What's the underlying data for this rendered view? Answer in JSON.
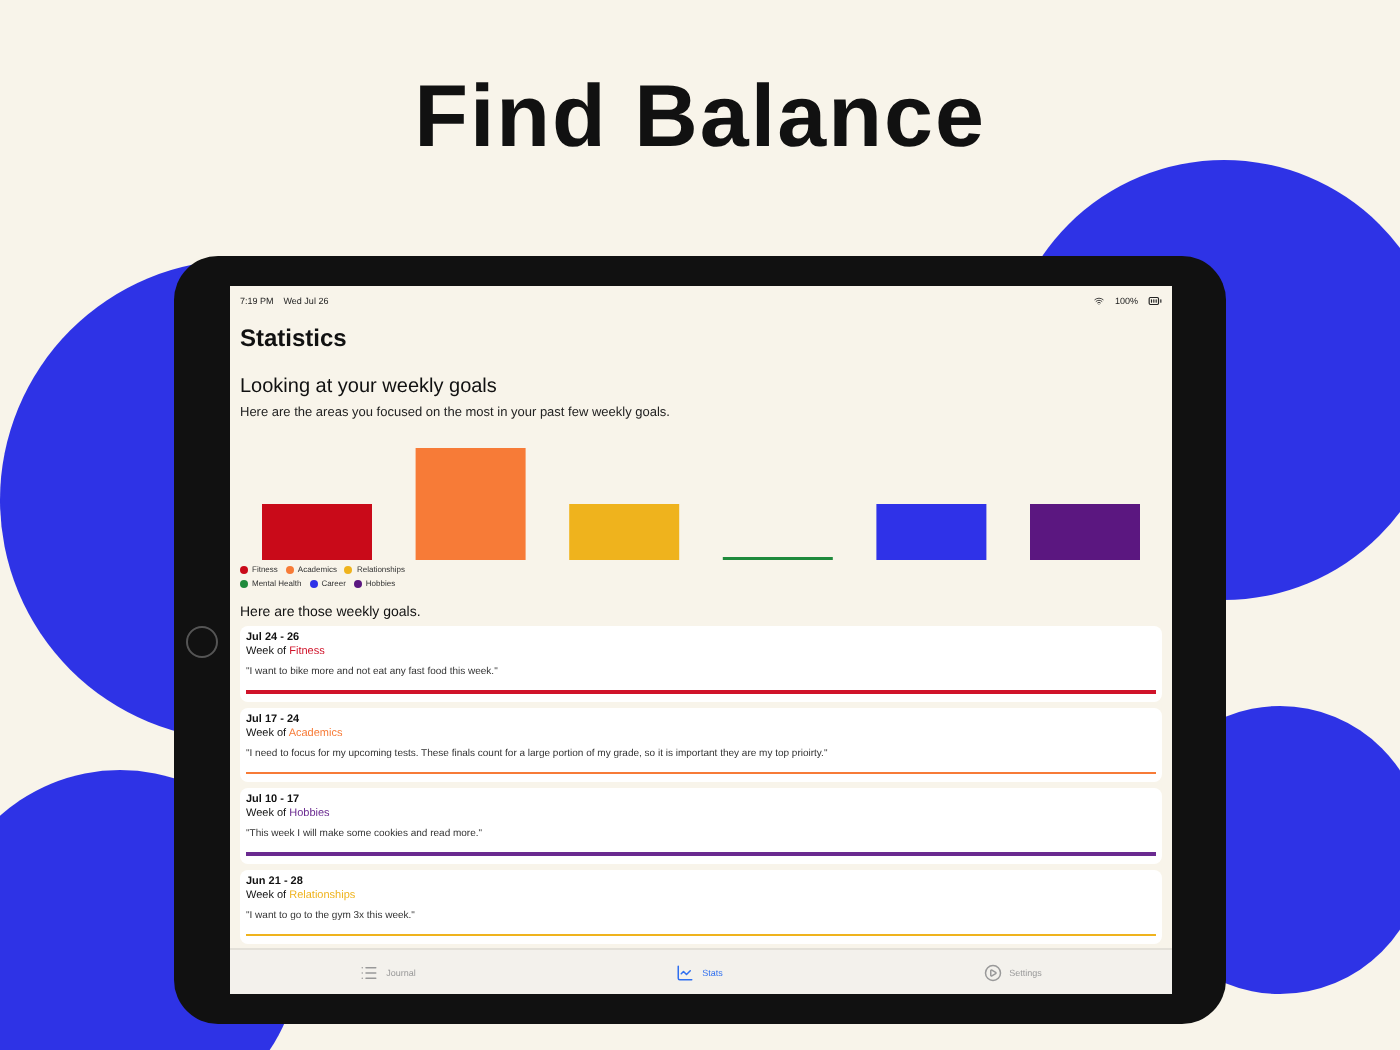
{
  "headline": "Find Balance",
  "status_bar": {
    "time": "7:19 PM",
    "date": "Wed Jul 26",
    "battery": "100%"
  },
  "screen_title": "Statistics",
  "section": {
    "heading": "Looking at your weekly goals",
    "subtitle": "Here are the areas you focused on the most in your past few weekly goals."
  },
  "legend_rows": [
    [
      {
        "label": "Fitness",
        "color": "#c90a19"
      },
      {
        "label": "Academics",
        "color": "#f77b37"
      },
      {
        "label": "Relationships",
        "color": "#efb31d"
      }
    ],
    [
      {
        "label": "Mental Health",
        "color": "#1f8a3c"
      },
      {
        "label": "Career",
        "color": "#2f32e8"
      },
      {
        "label": "Hobbies",
        "color": "#5b1780"
      }
    ]
  ],
  "goals_heading": "Here are those weekly goals.",
  "goals": [
    {
      "dates": "Jul 24 - 26",
      "week_label": "Week of",
      "category": "Fitness",
      "color": "#d0132a",
      "quote": "\"I want to bike more and not eat any fast food this week.\""
    },
    {
      "dates": "Jul 17 - 24",
      "week_label": "Week of",
      "category": "Academics",
      "color": "#f77b37",
      "quote": "\"I need to focus for my upcoming tests. These finals count for a large portion of my grade, so it is important they are my top prioirty.\""
    },
    {
      "dates": "Jul 10 - 17",
      "week_label": "Week of",
      "category": "Hobbies",
      "color": "#6a2a90",
      "quote": "\"This week I will make some cookies and read more.\""
    },
    {
      "dates": "Jun 21 - 28",
      "week_label": "Week of",
      "category": "Relationships",
      "color": "#efb31d",
      "quote": "\"I want to go to the gym 3x this week.\""
    }
  ],
  "tabs": [
    {
      "label": "Journal",
      "kind": "list",
      "selected": false
    },
    {
      "label": "Stats",
      "kind": "chart",
      "selected": true
    },
    {
      "label": "Settings",
      "kind": "circle",
      "selected": false
    }
  ]
}
